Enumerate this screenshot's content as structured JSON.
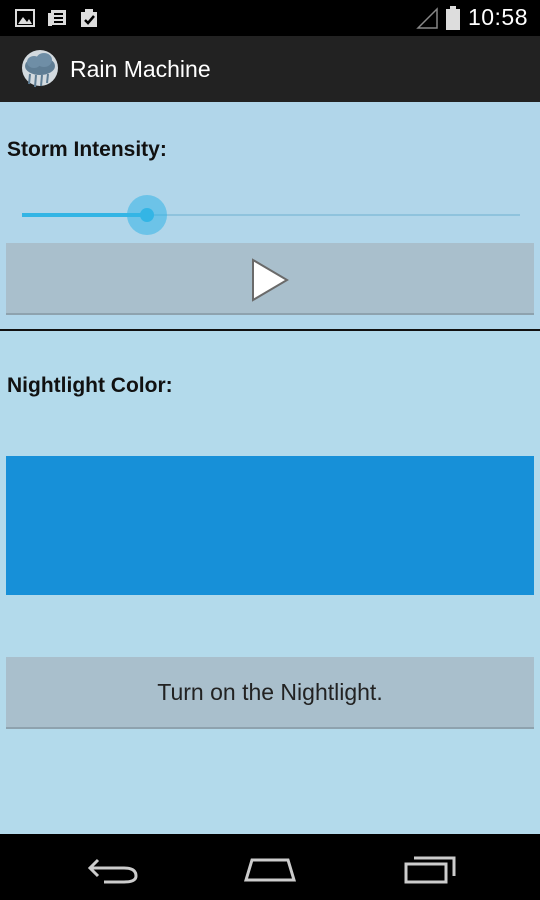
{
  "status_bar": {
    "time": "10:58",
    "icons": [
      "image-icon",
      "news-icon",
      "clipboard-check-icon",
      "signal-icon",
      "battery-icon"
    ]
  },
  "action_bar": {
    "title": "Rain Machine",
    "icon": "rain-cloud-icon"
  },
  "storm": {
    "label": "Storm Intensity:",
    "slider_fraction": 0.25,
    "play_icon": "play-icon"
  },
  "nightlight": {
    "label": "Nightlight Color:",
    "color": "#1790d8",
    "button_label": "Turn on the Nightlight."
  },
  "nav_bar": {
    "icons": [
      "back-icon",
      "home-icon",
      "recents-icon"
    ]
  },
  "colors": {
    "background": "#b3daeb",
    "accent": "#33b5e5",
    "button": "#a9bfcc",
    "action_bar": "#222222"
  }
}
